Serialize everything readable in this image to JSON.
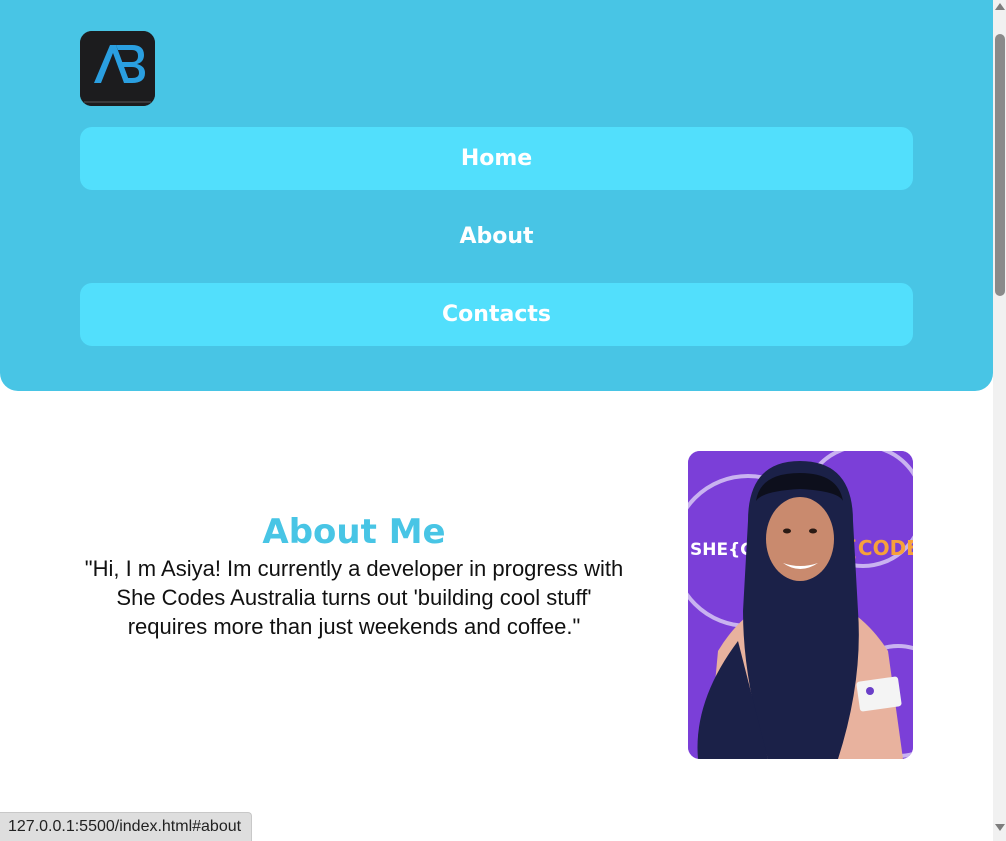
{
  "brand": {
    "logo_text": "AB",
    "accent_color": "#48c5e5",
    "button_color": "#52dffc"
  },
  "nav": {
    "items": [
      {
        "label": "Home"
      },
      {
        "label": "About"
      },
      {
        "label": "Contacts"
      }
    ]
  },
  "about": {
    "title": "About Me",
    "body": "\"Hi, I m Asiya! Im currently a developer in progress with She Codes Australia turns out 'building cool stuff' requires more than just weekends and coffee.\"",
    "photo_icon": "profile-photo",
    "photo_backdrop_text_left": "SHE{COD",
    "photo_backdrop_text_right": "E{CODES}"
  },
  "status_bar": {
    "url": "127.0.0.1:5500/index.html#about"
  }
}
